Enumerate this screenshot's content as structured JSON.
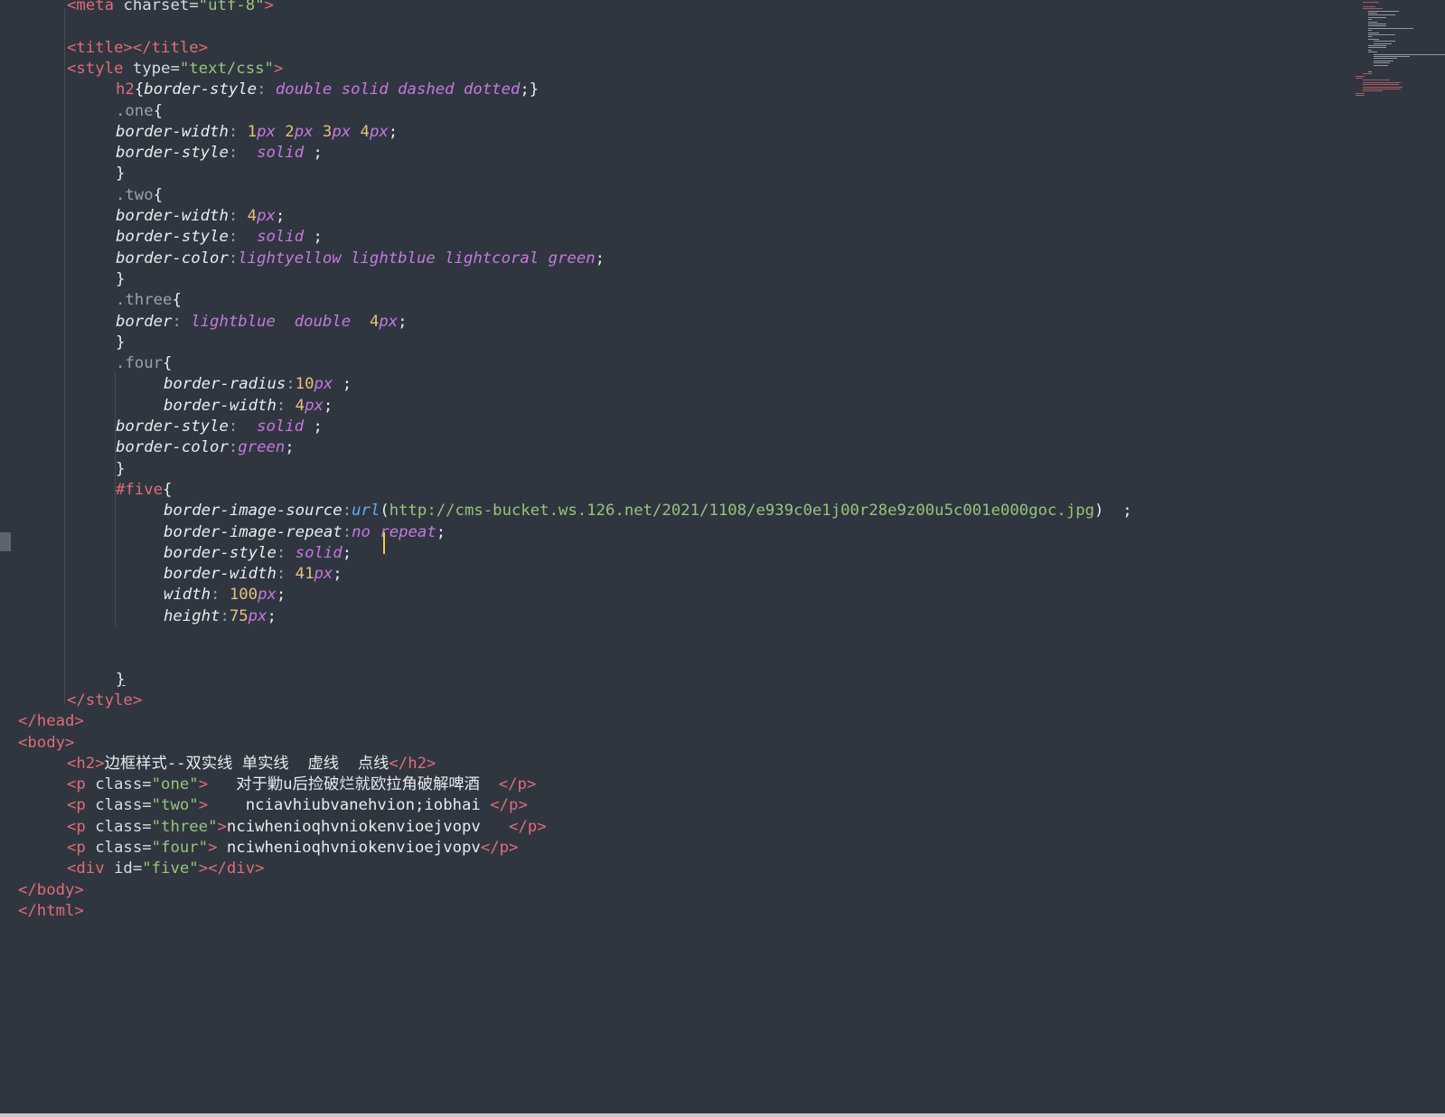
{
  "editor": {
    "lines": [
      [
        [
          "tg",
          "<meta "
        ],
        [
          "at",
          "charset="
        ],
        [
          "st",
          "\"utf-8\""
        ],
        [
          "tg",
          ">"
        ]
      ],
      [],
      [
        [
          "tg",
          "<title></title>"
        ]
      ],
      [
        [
          "tg",
          "<style "
        ],
        [
          "at",
          "type="
        ],
        [
          "st",
          "\"text/css\""
        ],
        [
          "tg",
          ">"
        ]
      ],
      [
        [
          "ch",
          "h2"
        ],
        [
          "pu",
          "{"
        ],
        [
          "pr",
          "border-style"
        ],
        [
          "cl",
          ": "
        ],
        [
          "va",
          "double solid dashed dotted"
        ],
        [
          "pu",
          ";}"
        ]
      ],
      [
        [
          "cl",
          ".one"
        ],
        [
          "pu",
          "{"
        ]
      ],
      [
        [
          "pr",
          "border-width"
        ],
        [
          "cl",
          ": "
        ],
        [
          "nm",
          "1"
        ],
        [
          "un",
          "px "
        ],
        [
          "nm",
          "2"
        ],
        [
          "un",
          "px "
        ],
        [
          "nm",
          "3"
        ],
        [
          "un",
          "px "
        ],
        [
          "nm",
          "4"
        ],
        [
          "un",
          "px"
        ],
        [
          "pu",
          ";"
        ]
      ],
      [
        [
          "pr",
          "border-style"
        ],
        [
          "cl",
          ":  "
        ],
        [
          "va",
          "solid"
        ],
        [
          "pu",
          " ;"
        ]
      ],
      [
        [
          "pu",
          "}"
        ]
      ],
      [
        [
          "cl",
          ".two"
        ],
        [
          "pu",
          "{"
        ]
      ],
      [
        [
          "pr",
          "border-width"
        ],
        [
          "cl",
          ": "
        ],
        [
          "nm",
          "4"
        ],
        [
          "un",
          "px"
        ],
        [
          "pu",
          ";"
        ]
      ],
      [
        [
          "pr",
          "border-style"
        ],
        [
          "cl",
          ":  "
        ],
        [
          "va",
          "solid"
        ],
        [
          "pu",
          " ;"
        ]
      ],
      [
        [
          "pr",
          "border-color"
        ],
        [
          "cl",
          ":"
        ],
        [
          "va",
          "lightyellow lightblue lightcoral green"
        ],
        [
          "pu",
          ";"
        ]
      ],
      [
        [
          "pu",
          "}"
        ]
      ],
      [
        [
          "cl",
          ".three"
        ],
        [
          "pu",
          "{"
        ]
      ],
      [
        [
          "pr",
          "border"
        ],
        [
          "cl",
          ": "
        ],
        [
          "va",
          "lightblue  double  "
        ],
        [
          "nm",
          "4"
        ],
        [
          "un",
          "px"
        ],
        [
          "pu",
          ";"
        ]
      ],
      [
        [
          "pu",
          "}"
        ]
      ],
      [
        [
          "cl",
          ".four"
        ],
        [
          "pu",
          "{"
        ]
      ],
      [
        [
          "pr",
          "border-radius"
        ],
        [
          "cl",
          ":"
        ],
        [
          "nm",
          "10"
        ],
        [
          "un",
          "px"
        ],
        [
          "pu",
          " ;"
        ]
      ],
      [
        [
          "pr",
          "border-width"
        ],
        [
          "cl",
          ": "
        ],
        [
          "nm",
          "4"
        ],
        [
          "un",
          "px"
        ],
        [
          "pu",
          ";"
        ]
      ],
      [
        [
          "pr",
          "border-style"
        ],
        [
          "cl",
          ":  "
        ],
        [
          "va",
          "solid"
        ],
        [
          "pu",
          " ;"
        ]
      ],
      [
        [
          "pr",
          "border-color"
        ],
        [
          "cl",
          ":"
        ],
        [
          "va",
          "green"
        ],
        [
          "pu",
          ";"
        ]
      ],
      [
        [
          "pu",
          "}"
        ]
      ],
      [
        [
          "ch",
          "#five"
        ],
        [
          "pu",
          "{"
        ]
      ],
      [
        [
          "pr",
          "border-image-source"
        ],
        [
          "cl",
          ":"
        ],
        [
          "fn",
          "url"
        ],
        [
          "pu",
          "("
        ],
        [
          "ur",
          "http://cms-bucket.ws.126.net/2021/1108/e939c0e1j00r28e9z00u5c001e000goc.jpg"
        ],
        [
          "pu",
          ")  ;"
        ]
      ],
      [
        [
          "pr",
          "border-image-repeat"
        ],
        [
          "cl",
          ":"
        ],
        [
          "va",
          "no"
        ],
        [
          "pu",
          " "
        ],
        [
          "va",
          "repeat"
        ],
        [
          "pu",
          ";"
        ]
      ],
      [
        [
          "pr",
          "border-style"
        ],
        [
          "cl",
          ": "
        ],
        [
          "va",
          "solid"
        ],
        [
          "pu",
          ";"
        ]
      ],
      [
        [
          "pr",
          "border-width"
        ],
        [
          "cl",
          ": "
        ],
        [
          "nm",
          "41"
        ],
        [
          "un",
          "px"
        ],
        [
          "pu",
          ";"
        ]
      ],
      [
        [
          "pr",
          "width"
        ],
        [
          "cl",
          ": "
        ],
        [
          "nm",
          "100"
        ],
        [
          "un",
          "px"
        ],
        [
          "pu",
          ";"
        ]
      ],
      [
        [
          "pr",
          "height"
        ],
        [
          "cl",
          ":"
        ],
        [
          "nm",
          "75"
        ],
        [
          "un",
          "px"
        ],
        [
          "pu",
          ";"
        ]
      ],
      [],
      [],
      [
        [
          "pu",
          "}"
        ]
      ],
      [
        [
          "tg",
          "</style>"
        ]
      ],
      [
        [
          "tg",
          "</head>"
        ]
      ],
      [
        [
          "tg",
          "<body>"
        ]
      ],
      [
        [
          "tg",
          "<h2>"
        ],
        [
          "tx",
          "边框样式--双实线 单实线  虚线  点线"
        ],
        [
          "tg",
          "</h2>"
        ]
      ],
      [
        [
          "tg",
          "<p "
        ],
        [
          "at",
          "class="
        ],
        [
          "st",
          "\"one\""
        ],
        [
          "tg",
          ">"
        ],
        [
          "tx",
          "   对于勦u后捡破烂就欧拉角破解啤酒  "
        ],
        [
          "tg",
          "</p>"
        ]
      ],
      [
        [
          "tg",
          "<p "
        ],
        [
          "at",
          "class="
        ],
        [
          "st",
          "\"two\""
        ],
        [
          "tg",
          ">"
        ],
        [
          "tx",
          "    nciavhiubvanehvion;iobhai "
        ],
        [
          "tg",
          "</p>"
        ]
      ],
      [
        [
          "tg",
          "<p "
        ],
        [
          "at",
          "class="
        ],
        [
          "st",
          "\"three\""
        ],
        [
          "tg",
          ">"
        ],
        [
          "tx",
          "nciwhenioqhvniokenvioejvopv   "
        ],
        [
          "tg",
          "</p>"
        ]
      ],
      [
        [
          "tg",
          "<p "
        ],
        [
          "at",
          "class="
        ],
        [
          "st",
          "\"four\""
        ],
        [
          "tg",
          ">"
        ],
        [
          "tx",
          " nciwhenioqhvniokenvioejvopv"
        ],
        [
          "tg",
          "</p>"
        ]
      ],
      [
        [
          "tg",
          "<div "
        ],
        [
          "at",
          "id="
        ],
        [
          "st",
          "\"five\""
        ],
        [
          "tg",
          "></div>"
        ]
      ],
      [
        [
          "tg",
          "</body>"
        ]
      ],
      [
        [
          "tg",
          "</html>"
        ]
      ]
    ]
  },
  "colors": {
    "background": "#2f3640",
    "caret": "#f7ca3e"
  }
}
